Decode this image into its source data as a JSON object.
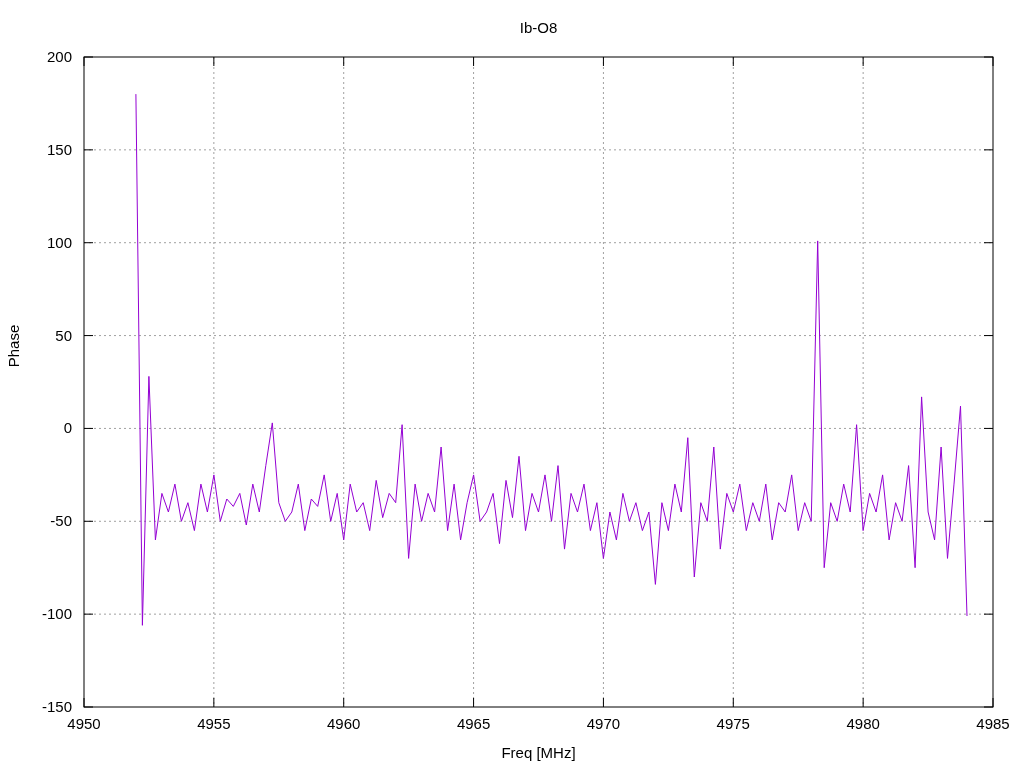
{
  "chart_data": {
    "type": "line",
    "title": "Ib-O8",
    "xlabel": "Freq [MHz]",
    "ylabel": "Phase",
    "grid": true,
    "xlim": [
      4950,
      4985
    ],
    "ylim": [
      -150,
      200
    ],
    "xticks": [
      4950,
      4955,
      4960,
      4965,
      4970,
      4975,
      4980,
      4985
    ],
    "yticks": [
      -150,
      -100,
      -50,
      0,
      50,
      100,
      150,
      200
    ],
    "x": [
      4952,
      4952.25,
      4952.5,
      4952.75,
      4953,
      4953.25,
      4953.5,
      4953.75,
      4954,
      4954.25,
      4954.5,
      4954.75,
      4955,
      4955.25,
      4955.5,
      4955.75,
      4956,
      4956.25,
      4956.5,
      4956.75,
      4957,
      4957.25,
      4957.5,
      4957.75,
      4958,
      4958.25,
      4958.5,
      4958.75,
      4959,
      4959.25,
      4959.5,
      4959.75,
      4960,
      4960.25,
      4960.5,
      4960.75,
      4961,
      4961.25,
      4961.5,
      4961.75,
      4962,
      4962.25,
      4962.5,
      4962.75,
      4963,
      4963.25,
      4963.5,
      4963.75,
      4964,
      4964.25,
      4964.5,
      4964.75,
      4965,
      4965.25,
      4965.5,
      4965.75,
      4966,
      4966.25,
      4966.5,
      4966.75,
      4967,
      4967.25,
      4967.5,
      4967.75,
      4968,
      4968.25,
      4968.5,
      4968.75,
      4969,
      4969.25,
      4969.5,
      4969.75,
      4970,
      4970.25,
      4970.5,
      4970.75,
      4971,
      4971.25,
      4971.5,
      4971.75,
      4972,
      4972.25,
      4972.5,
      4972.75,
      4973,
      4973.25,
      4973.5,
      4973.75,
      4974,
      4974.25,
      4974.5,
      4974.75,
      4975,
      4975.25,
      4975.5,
      4975.75,
      4976,
      4976.25,
      4976.5,
      4976.75,
      4977,
      4977.25,
      4977.5,
      4977.75,
      4978,
      4978.25,
      4978.5,
      4978.75,
      4979,
      4979.25,
      4979.5,
      4979.75,
      4980,
      4980.25,
      4980.5,
      4980.75,
      4981,
      4981.25,
      4981.5,
      4981.75,
      4982,
      4982.25,
      4982.5,
      4982.75,
      4983,
      4983.25,
      4983.5,
      4983.75,
      4984
    ],
    "series": [
      {
        "color": "#9400d3",
        "values": [
          180,
          -106,
          28,
          -60,
          -35,
          -45,
          -30,
          -50,
          -40,
          -55,
          -30,
          -45,
          -25,
          -50,
          -38,
          -42,
          -35,
          -52,
          -30,
          -45,
          -20,
          3,
          -40,
          -50,
          -45,
          -30,
          -55,
          -38,
          -42,
          -25,
          -50,
          -35,
          -60,
          -30,
          -45,
          -40,
          -55,
          -28,
          -48,
          -35,
          -40,
          2,
          -70,
          -30,
          -50,
          -35,
          -45,
          -10,
          -55,
          -30,
          -60,
          -40,
          -25,
          -50,
          -45,
          -35,
          -62,
          -28,
          -48,
          -15,
          -55,
          -35,
          -45,
          -25,
          -50,
          -20,
          -65,
          -35,
          -45,
          -30,
          -55,
          -40,
          -70,
          -45,
          -60,
          -35,
          -50,
          -40,
          -55,
          -45,
          -84,
          -40,
          -55,
          -30,
          -45,
          -5,
          -80,
          -40,
          -50,
          -10,
          -65,
          -35,
          -45,
          -30,
          -55,
          -40,
          -50,
          -30,
          -60,
          -40,
          -45,
          -25,
          -55,
          -40,
          -50,
          101,
          -75,
          -40,
          -50,
          -30,
          -45,
          2,
          -55,
          -35,
          -45,
          -25,
          -60,
          -40,
          -50,
          -20,
          -75,
          17,
          -45,
          -60,
          -10,
          -70,
          -30,
          12,
          -101
        ]
      }
    ]
  }
}
